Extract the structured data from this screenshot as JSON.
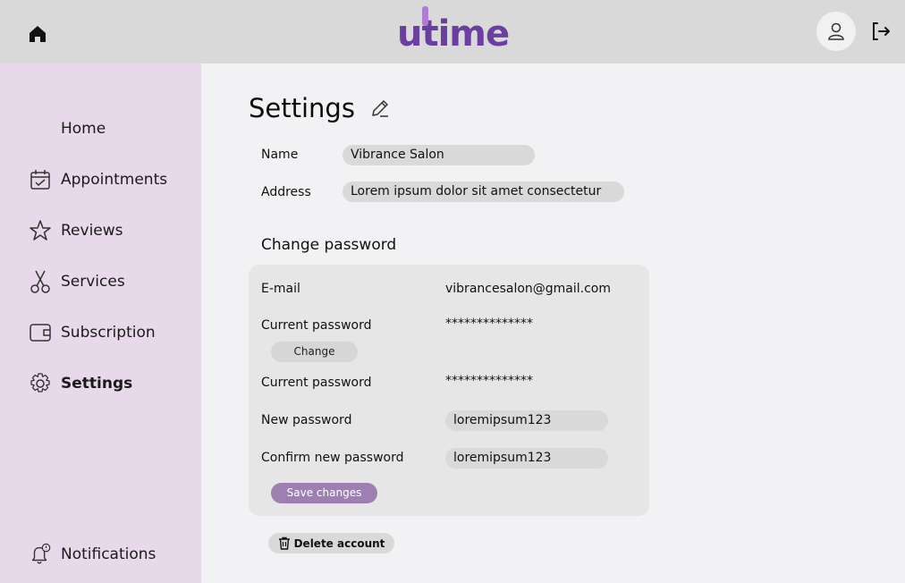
{
  "header": {
    "logo_text": "utime",
    "icons": {
      "home": "home-icon",
      "user": "user-icon",
      "logout": "logout-icon"
    }
  },
  "sidebar": {
    "items": [
      {
        "label": "Home",
        "icon": "none"
      },
      {
        "label": "Appointments",
        "icon": "calendar-icon"
      },
      {
        "label": "Reviews",
        "icon": "star-icon"
      },
      {
        "label": "Services",
        "icon": "scissors-icon"
      },
      {
        "label": "Subscription",
        "icon": "wallet-icon"
      },
      {
        "label": "Settings",
        "icon": "gear-icon",
        "active": true
      }
    ],
    "notifications_label": "Notifications"
  },
  "settings": {
    "title": "Settings",
    "name_label": "Name",
    "name_value": "Vibrance Salon",
    "address_label": "Address",
    "address_value": "Lorem ipsum dolor sit amet consectetur"
  },
  "password": {
    "section_title": "Change password",
    "email_label": "E-mail",
    "email_value": "vibrancesalon@gmail.com",
    "current_label": "Current password",
    "current_value": "**************",
    "change_button": "Change",
    "current_label_2": "Current password",
    "current_value_2": "**************",
    "new_label": "New password",
    "new_value": "loremipsum123",
    "confirm_label": "Confirm new password",
    "confirm_value": "loremipsum123",
    "save_button": "Save changes"
  },
  "delete_button": "Delete account",
  "colors": {
    "topbar": "#d9d9d9",
    "sidebar": "#e8d9ea",
    "accent": "#9d7fb2",
    "logo": "#6b3fa0"
  }
}
